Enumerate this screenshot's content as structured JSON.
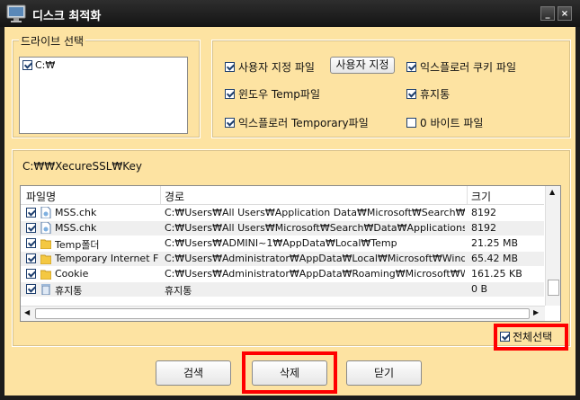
{
  "window": {
    "title": "디스크 최적화",
    "minimize_label": "_",
    "close_label": "×"
  },
  "drive_group": {
    "label": "드라이브 선택",
    "drives": [
      "C:₩"
    ]
  },
  "options": {
    "user_path_files": "사용자 지정 파일",
    "user_path_button": "사용자 지정",
    "explorer_cookie": "익스플로러 쿠키 파일",
    "windows_temp": "윈도우 Temp파일",
    "recycle_bin": "휴지통",
    "explorer_temporary": "익스플로러 Temporary파일",
    "zero_byte": "0 바이트 파일"
  },
  "current_path": "C:₩₩XecureSSL₩Key",
  "table": {
    "columns": [
      "파일명",
      "경로",
      "크기"
    ],
    "rows": [
      {
        "name": "MSS.chk",
        "path": "C:₩Users₩All Users₩Application Data₩Microsoft₩Search₩Dat...",
        "size": "8192",
        "icon": "file-icon",
        "checked": true
      },
      {
        "name": "MSS.chk",
        "path": "C:₩Users₩All Users₩Microsoft₩Search₩Data₩Applications₩...",
        "size": "8192",
        "icon": "file-icon",
        "checked": true
      },
      {
        "name": "Temp폴더",
        "path": "C:₩Users₩ADMINI~1₩AppData₩Local₩Temp",
        "size": "21.25 MB",
        "icon": "folder-icon",
        "checked": true
      },
      {
        "name": "Temporary Internet Files",
        "path": "C:₩Users₩Administrator₩AppData₩Local₩Microsoft₩Windows...",
        "size": "65.42 MB",
        "icon": "folder-icon",
        "checked": true
      },
      {
        "name": "Cookie",
        "path": "C:₩Users₩Administrator₩AppData₩Roaming₩Microsoft₩Wind...",
        "size": "161.25 KB",
        "icon": "folder-icon",
        "checked": true
      },
      {
        "name": "휴지통",
        "path": "휴지통",
        "size": "0 B",
        "icon": "recycle-bin-icon",
        "checked": true
      }
    ]
  },
  "select_all": "전체선택",
  "buttons": {
    "search": "검색",
    "delete": "삭제",
    "close": "닫기"
  },
  "colors": {
    "background": "#fde3a2",
    "highlight": "#ff0000",
    "titlebar": "#1c1c1c"
  }
}
